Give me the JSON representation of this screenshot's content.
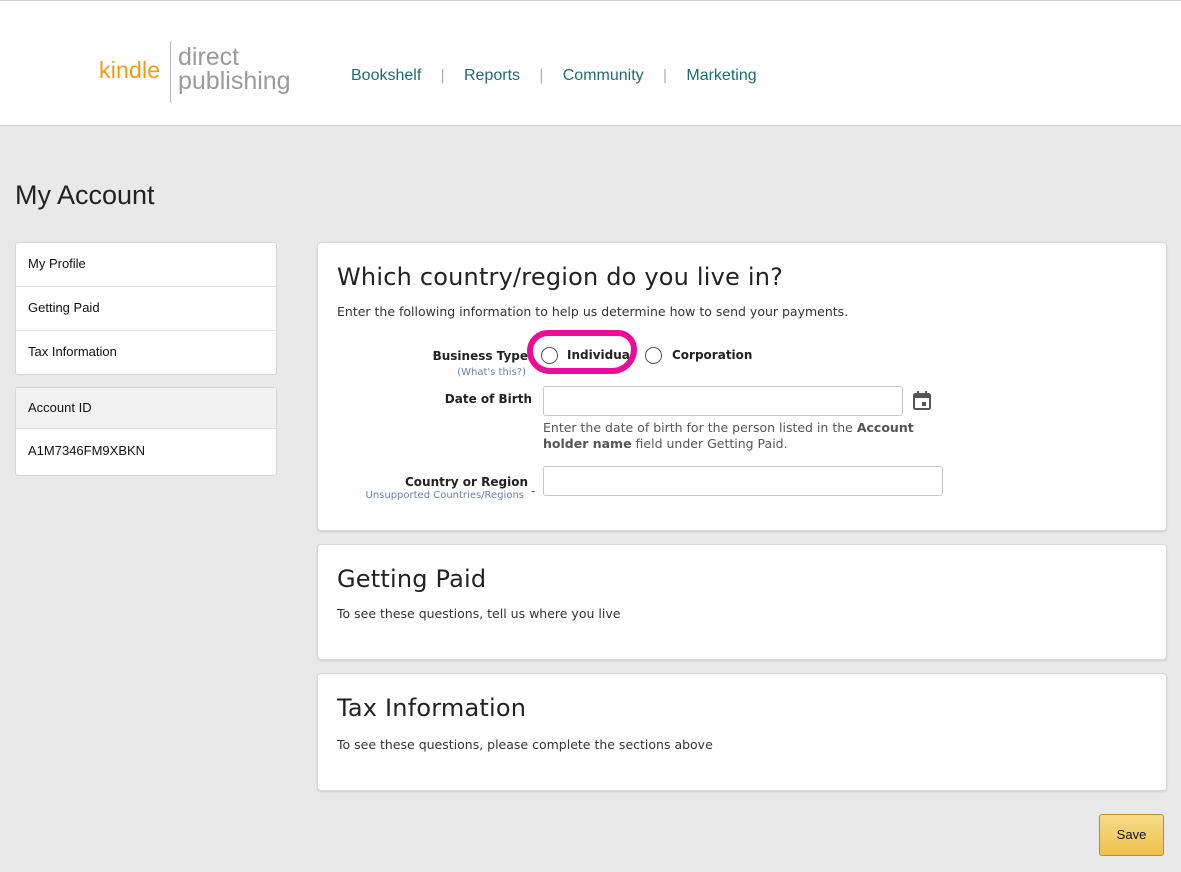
{
  "brand": {
    "kindle": "kindle",
    "direct": "direct",
    "publishing": "publishing",
    "kindle_color": "#f49b15"
  },
  "nav": {
    "items": [
      {
        "label": "Bookshelf"
      },
      {
        "label": "Reports"
      },
      {
        "label": "Community"
      },
      {
        "label": "Marketing"
      }
    ],
    "separator": "|"
  },
  "page_title": "My Account",
  "sidebar": {
    "items": [
      {
        "label": "My Profile"
      },
      {
        "label": "Getting Paid"
      },
      {
        "label": "Tax Information"
      }
    ],
    "account": {
      "heading": "Account ID",
      "value": "A1M7346FM9XBKN"
    }
  },
  "country_section": {
    "title": "Which country/region do you live in?",
    "subtitle": "Enter the following information to help us determine how to send your payments.",
    "business_type": {
      "label": "Business Type",
      "help": "(What's this?)",
      "options": [
        {
          "label": "Individual",
          "selected": false
        },
        {
          "label": "Corporation",
          "selected": false
        }
      ],
      "highlighted_option": "Individual",
      "highlight_color": "#ee0b9b"
    },
    "date_of_birth": {
      "label": "Date of Birth",
      "value": "",
      "hint_before": "Enter the date of birth for the person listed in the",
      "hint_bold": "Account holder name",
      "hint_after": "field under Getting Paid.",
      "icon": "calendar-icon"
    },
    "country": {
      "label": "Country or Region",
      "help": "Unsupported Countries/Regions",
      "value": ""
    }
  },
  "getting_paid": {
    "title": "Getting Paid",
    "text": "To see these questions, tell us where you live"
  },
  "tax_information": {
    "title": "Tax Information",
    "text": "To see these questions, please complete the sections above"
  },
  "save_label": "Save",
  "colors": {
    "nav_link": "#1d6b76",
    "save_button": "#f0c14b",
    "background": "#e9e9e9"
  }
}
